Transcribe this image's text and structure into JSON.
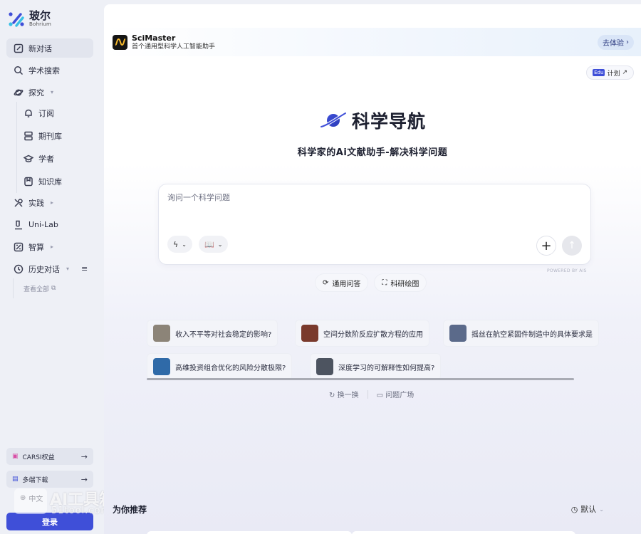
{
  "brand": {
    "name_cn": "玻尔",
    "name_en": "Bohrium"
  },
  "sidebar": {
    "items": [
      {
        "label": "新对话",
        "icon": "edit-icon"
      },
      {
        "label": "学术搜索",
        "icon": "search-icon"
      },
      {
        "label": "探究",
        "icon": "planet-icon"
      },
      {
        "label": "订阅",
        "icon": "bell-icon"
      },
      {
        "label": "期刊库",
        "icon": "journal-icon"
      },
      {
        "label": "学者",
        "icon": "scholar-icon"
      },
      {
        "label": "知识库",
        "icon": "knowledge-icon"
      },
      {
        "label": "实践",
        "icon": "tools-icon"
      },
      {
        "label": "Uni-Lab",
        "icon": "lab-icon"
      },
      {
        "label": "智算",
        "icon": "compute-icon"
      },
      {
        "label": "历史对话",
        "icon": "history-icon"
      }
    ],
    "view_all": "查看全部",
    "carsi": "CARSI权益",
    "download": "多端下载",
    "lang": "中文",
    "login": "登录"
  },
  "watermark": {
    "cn": "AI工具箱",
    "en": "51tool.com"
  },
  "banner": {
    "title": "SciMaster",
    "subtitle": "首个通用型科学人工智能助手",
    "cta": "去体验"
  },
  "plan": {
    "tag": "Edu",
    "label": "计划"
  },
  "hero": {
    "title": "科学导航",
    "subtitle": "科学家的Ai文献助手-解决科学问题"
  },
  "ask": {
    "placeholder": "询问一个科学问题",
    "powered": "POWERED BY AIS"
  },
  "modes": [
    {
      "label": "通用问答",
      "icon": "refresh-chat-icon"
    },
    {
      "label": "科研绘图",
      "icon": "image-icon"
    }
  ],
  "questions": [
    {
      "text": "收入不平等对社会稳定的影响?",
      "color": "#8c8478"
    },
    {
      "text": "空间分数阶反应扩散方程的应用",
      "color": "#7a3a2c"
    },
    {
      "text": "摇丝在航空紧固件制造中的具体要求是",
      "color": "#5b6a8a"
    },
    {
      "text": "高维投资组合优化的风险分散极限?",
      "color": "#2f6aa8"
    },
    {
      "text": "深度学习的可解释性如何提高?",
      "color": "#4d5460"
    }
  ],
  "utils": {
    "shuffle": "换一换",
    "plaza": "问题广场"
  },
  "recommend": {
    "title": "为你推荐",
    "sort": "默认"
  },
  "colors": {
    "accent": "#3f4fd8",
    "sidebar_bg": "#eef0f6"
  }
}
